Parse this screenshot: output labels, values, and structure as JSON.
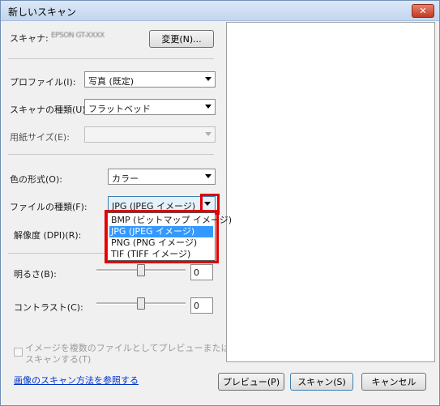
{
  "window": {
    "title": "新しいスキャン",
    "close_symbol": "✕"
  },
  "scanner": {
    "label": "スキャナ:",
    "name": "EPSON GT-XXXX",
    "change_button": "変更(N)..."
  },
  "profile": {
    "label": "プロファイル(I):",
    "value": "写真 (既定)"
  },
  "source": {
    "label": "スキャナの種類(U):",
    "value": "フラットベッド"
  },
  "paper_size": {
    "label": "用紙サイズ(E):",
    "value": ""
  },
  "color_format": {
    "label": "色の形式(O):",
    "value": "カラー"
  },
  "file_type": {
    "label": "ファイルの種類(F):",
    "value": "JPG (JPEG イメージ)",
    "options": [
      "BMP (ビットマップ イメージ)",
      "JPG (JPEG イメージ)",
      "PNG (PNG イメージ)",
      "TIF (TIFF イメージ)"
    ],
    "selected_index": 1
  },
  "resolution": {
    "label": "解像度 (DPI)(R):"
  },
  "brightness": {
    "label": "明るさ(B):",
    "value": "0",
    "level": 0.5
  },
  "contrast": {
    "label": "コントラスト(C):",
    "value": "0",
    "level": 0.5
  },
  "multi_file": {
    "label_line1": "イメージを複数のファイルとしてプレビューまたは",
    "label_line2": "スキャンする(T)",
    "checked": false
  },
  "help_link": "画像のスキャン方法を参照する",
  "buttons": {
    "preview": "プレビュー(P)",
    "scan": "スキャン(S)",
    "cancel": "キャンセル"
  },
  "colors": {
    "highlight": "#3399ff",
    "annotation": "#e00000",
    "link": "#0033cc"
  }
}
